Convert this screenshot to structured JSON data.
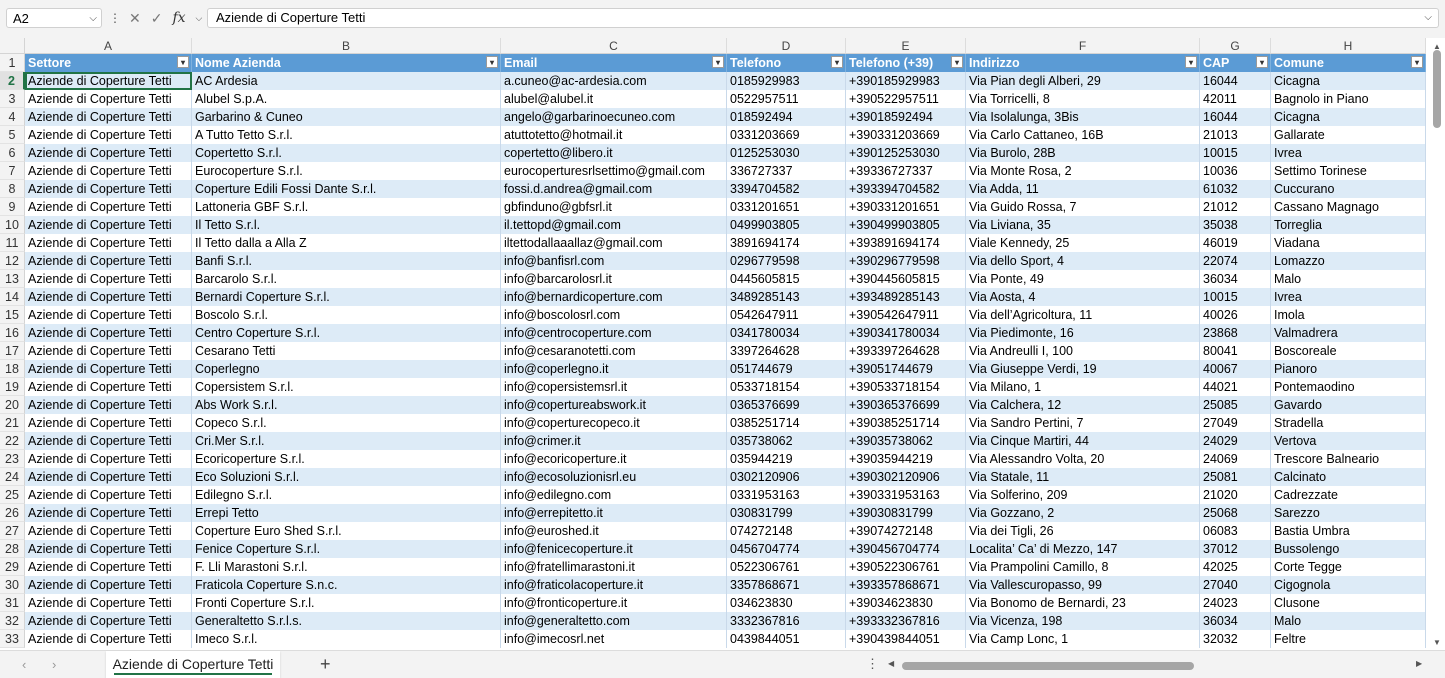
{
  "formula_bar": {
    "name_box": "A2",
    "formula": "Aziende di Coperture Tetti",
    "cancel_icon": "x-icon",
    "confirm_icon": "check-icon",
    "fx_label": "fx"
  },
  "columns": [
    "A",
    "B",
    "C",
    "D",
    "E",
    "F",
    "G",
    "H"
  ],
  "headers": [
    "Settore",
    "Nome Azienda",
    "Email",
    "Telefono",
    "Telefono (+39)",
    "Indirizzo",
    "CAP",
    "Comune"
  ],
  "rows": [
    {
      "num": "2",
      "cells": [
        "Aziende di Coperture Tetti",
        "AC Ardesia",
        "a.cuneo@ac-ardesia.com",
        "0185929983",
        "+390185929983",
        "Via Pian degli Alberi, 29",
        "16044",
        "Cicagna"
      ]
    },
    {
      "num": "3",
      "cells": [
        "Aziende di Coperture Tetti",
        "Alubel S.p.A.",
        "alubel@alubel.it",
        "0522957511",
        "+390522957511",
        "Via Torricelli, 8",
        "42011",
        "Bagnolo in Piano"
      ]
    },
    {
      "num": "4",
      "cells": [
        "Aziende di Coperture Tetti",
        "Garbarino & Cuneo",
        "angelo@garbarinoecuneo.com",
        "018592494",
        "+39018592494",
        "Via Isolalunga, 3Bis",
        "16044",
        "Cicagna"
      ]
    },
    {
      "num": "5",
      "cells": [
        "Aziende di Coperture Tetti",
        "A Tutto Tetto S.r.l.",
        "atuttotetto@hotmail.it",
        "0331203669",
        "+390331203669",
        "Via Carlo Cattaneo, 16B",
        "21013",
        "Gallarate"
      ]
    },
    {
      "num": "6",
      "cells": [
        "Aziende di Coperture Tetti",
        "Copertetto S.r.l.",
        "copertetto@libero.it",
        "0125253030",
        "+390125253030",
        "Via Burolo, 28B",
        "10015",
        "Ivrea"
      ]
    },
    {
      "num": "7",
      "cells": [
        "Aziende di Coperture Tetti",
        "Eurocoperture S.r.l.",
        "eurocoperturesrlsettimo@gmail.com",
        "336727337",
        "+39336727337",
        "Via Monte Rosa, 2",
        "10036",
        "Settimo Torinese"
      ]
    },
    {
      "num": "8",
      "cells": [
        "Aziende di Coperture Tetti",
        "Coperture Edili Fossi Dante S.r.l.",
        "fossi.d.andrea@gmail.com",
        "3394704582",
        "+393394704582",
        "Via Adda, 11",
        "61032",
        "Cuccurano"
      ]
    },
    {
      "num": "9",
      "cells": [
        "Aziende di Coperture Tetti",
        "Lattoneria GBF S.r.l.",
        "gbfinduno@gbfsrl.it",
        "0331201651",
        "+390331201651",
        "Via Guido Rossa, 7",
        "21012",
        "Cassano Magnago"
      ]
    },
    {
      "num": "10",
      "cells": [
        "Aziende di Coperture Tetti",
        "Il Tetto S.r.l.",
        "il.tettopd@gmail.com",
        "0499903805",
        "+390499903805",
        "Via Liviana, 35",
        "35038",
        "Torreglia"
      ]
    },
    {
      "num": "11",
      "cells": [
        "Aziende di Coperture Tetti",
        "Il Tetto dalla a Alla Z",
        "iltettodallaaallaz@gmail.com",
        "3891694174",
        "+393891694174",
        "Viale Kennedy, 25",
        "46019",
        "Viadana"
      ]
    },
    {
      "num": "12",
      "cells": [
        "Aziende di Coperture Tetti",
        "Banfi S.r.l.",
        "info@banfisrl.com",
        "0296779598",
        "+390296779598",
        "Via dello Sport, 4",
        "22074",
        "Lomazzo"
      ]
    },
    {
      "num": "13",
      "cells": [
        "Aziende di Coperture Tetti",
        "Barcarolo S.r.l.",
        "info@barcarolosrl.it",
        "0445605815",
        "+390445605815",
        "Via Ponte, 49",
        "36034",
        "Malo"
      ]
    },
    {
      "num": "14",
      "cells": [
        "Aziende di Coperture Tetti",
        "Bernardi Coperture S.r.l.",
        "info@bernardicoperture.com",
        "3489285143",
        "+393489285143",
        "Via Aosta, 4",
        "10015",
        "Ivrea"
      ]
    },
    {
      "num": "15",
      "cells": [
        "Aziende di Coperture Tetti",
        "Boscolo S.r.l.",
        "info@boscolosrl.com",
        "0542647911",
        "+390542647911",
        "Via dell’Agricoltura, 11",
        "40026",
        "Imola"
      ]
    },
    {
      "num": "16",
      "cells": [
        "Aziende di Coperture Tetti",
        "Centro Coperture S.r.l.",
        "info@centrocoperture.com",
        "0341780034",
        "+390341780034",
        "Via Piedimonte, 16",
        "23868",
        "Valmadrera"
      ]
    },
    {
      "num": "17",
      "cells": [
        "Aziende di Coperture Tetti",
        "Cesarano Tetti",
        "info@cesaranotetti.com",
        "3397264628",
        "+393397264628",
        "Via Andreulli I, 100",
        "80041",
        "Boscoreale"
      ]
    },
    {
      "num": "18",
      "cells": [
        "Aziende di Coperture Tetti",
        "Coperlegno",
        "info@coperlegno.it",
        "051744679",
        "+39051744679",
        "Via Giuseppe Verdi, 19",
        "40067",
        "Pianoro"
      ]
    },
    {
      "num": "19",
      "cells": [
        "Aziende di Coperture Tetti",
        "Copersistem S.r.l.",
        "info@copersistemsrl.it",
        "0533718154",
        "+390533718154",
        "Via Milano, 1",
        "44021",
        "Pontemaodino"
      ]
    },
    {
      "num": "20",
      "cells": [
        "Aziende di Coperture Tetti",
        "Abs Work S.r.l.",
        "info@copertureabswork.it",
        "0365376699",
        "+390365376699",
        "Via Calchera, 12",
        "25085",
        "Gavardo"
      ]
    },
    {
      "num": "21",
      "cells": [
        "Aziende di Coperture Tetti",
        "Copeco S.r.l.",
        "info@coperturecopeco.it",
        "0385251714",
        "+390385251714",
        "Via Sandro Pertini, 7",
        "27049",
        "Stradella"
      ]
    },
    {
      "num": "22",
      "cells": [
        "Aziende di Coperture Tetti",
        "Cri.Mer S.r.l.",
        "info@crimer.it",
        "035738062",
        "+39035738062",
        "Via Cinque Martiri, 44",
        "24029",
        "Vertova"
      ]
    },
    {
      "num": "23",
      "cells": [
        "Aziende di Coperture Tetti",
        "Ecoricoperture S.r.l.",
        "info@ecoricoperture.it",
        "035944219",
        "+39035944219",
        "Via Alessandro Volta, 20",
        "24069",
        "Trescore Balneario"
      ]
    },
    {
      "num": "24",
      "cells": [
        "Aziende di Coperture Tetti",
        "Eco Soluzioni S.r.l.",
        "info@ecosoluzionisrl.eu",
        "0302120906",
        "+390302120906",
        "Via Statale, 11",
        "25081",
        "Calcinato"
      ]
    },
    {
      "num": "25",
      "cells": [
        "Aziende di Coperture Tetti",
        "Edilegno S.r.l.",
        "info@edilegno.com",
        "0331953163",
        "+390331953163",
        "Via Solferino, 209",
        "21020",
        "Cadrezzate"
      ]
    },
    {
      "num": "26",
      "cells": [
        "Aziende di Coperture Tetti",
        "Errepi Tetto",
        "info@errepitetto.it",
        "030831799",
        "+39030831799",
        "Via Gozzano, 2",
        "25068",
        "Sarezzo"
      ]
    },
    {
      "num": "27",
      "cells": [
        "Aziende di Coperture Tetti",
        "Coperture Euro Shed S.r.l.",
        "info@euroshed.it",
        "074272148",
        "+39074272148",
        "Via dei Tigli, 26",
        "06083",
        "Bastia Umbra"
      ]
    },
    {
      "num": "28",
      "cells": [
        "Aziende di Coperture Tetti",
        "Fenice Coperture S.r.l.",
        "info@fenicecoperture.it",
        "0456704774",
        "+390456704774",
        "Localita’ Ca’ di Mezzo, 147",
        "37012",
        "Bussolengo"
      ]
    },
    {
      "num": "29",
      "cells": [
        "Aziende di Coperture Tetti",
        "F. Lli Marastoni S.r.l.",
        "info@fratellimarastoni.it",
        "0522306761",
        "+390522306761",
        "Via Prampolini Camillo, 8",
        "42025",
        "Corte Tegge"
      ]
    },
    {
      "num": "30",
      "cells": [
        "Aziende di Coperture Tetti",
        "Fraticola Coperture S.n.c.",
        "info@fraticolacoperture.it",
        "3357868671",
        "+393357868671",
        "Via Vallescuropasso, 99",
        "27040",
        "Cigognola"
      ]
    },
    {
      "num": "31",
      "cells": [
        "Aziende di Coperture Tetti",
        "Fronti Coperture S.r.l.",
        "info@fronticoperture.it",
        "034623830",
        "+39034623830",
        "Via Bonomo de Bernardi, 23",
        "24023",
        "Clusone"
      ]
    },
    {
      "num": "32",
      "cells": [
        "Aziende di Coperture Tetti",
        "Generaltetto S.r.l.s.",
        "info@generaltetto.com",
        "3332367816",
        "+393332367816",
        "Via Vicenza, 198",
        "36034",
        "Malo"
      ]
    },
    {
      "num": "33",
      "cells": [
        "Aziende di Coperture Tetti",
        "Imeco S.r.l.",
        "info@imecosrl.net",
        "0439844051",
        "+390439844051",
        "Via Camp Lonc, 1",
        "32032",
        "Feltre"
      ]
    }
  ],
  "header_row_num": "1",
  "sheet_tabs": [
    "Aziende di Coperture Tetti"
  ],
  "add_sheet_label": "+",
  "colors": {
    "header_fill": "#5b9bd5",
    "band_fill": "#ddebf7",
    "accent": "#217346"
  }
}
